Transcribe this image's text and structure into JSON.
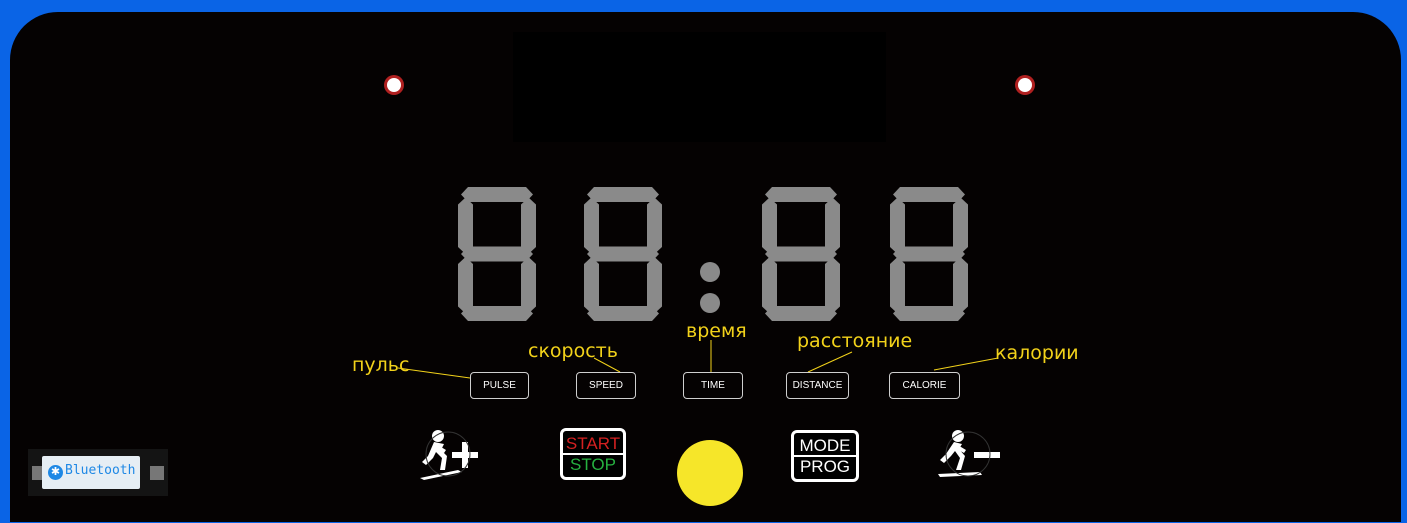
{
  "display": {
    "time_text": "88:88"
  },
  "labels": {
    "pulse": "пульс",
    "speed": "скорость",
    "time": "время",
    "distance": "расстояние",
    "calorie": "калории"
  },
  "modes": {
    "pulse": "PULSE",
    "speed": "SPEED",
    "time": "TIME",
    "distance": "DISTANCE",
    "calorie": "CALORIE"
  },
  "controls": {
    "start": "START",
    "stop": "STOP",
    "mode": "MODE",
    "prog": "PROG"
  },
  "bluetooth": {
    "label": "Bluetooth"
  },
  "colors": {
    "panel": "#050202",
    "frame": "#0a64e6",
    "segment": "#8a8a8a",
    "label": "#f2d21a",
    "start": "#d42020",
    "stop": "#26b040",
    "round_button": "#f6e629"
  },
  "icons": {
    "speed_up": "runner-plus-icon",
    "speed_down": "runner-minus-icon",
    "bluetooth": "bluetooth-icon"
  }
}
